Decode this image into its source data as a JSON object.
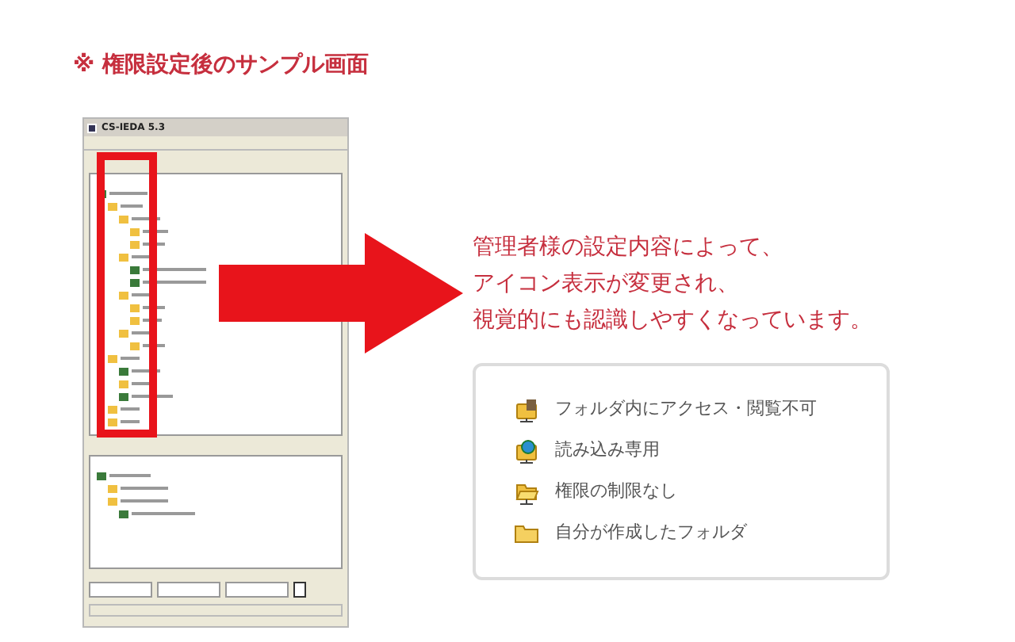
{
  "heading": "※ 権限設定後のサンプル画面",
  "screenshot": {
    "title": "CS-IEDA 5.3"
  },
  "message": [
    "管理者様の設定内容によって、",
    "アイコン表示が変更され、",
    "視覚的にも認識しやすくなっています。"
  ],
  "legend": [
    {
      "kind": "locked",
      "label": "フォルダ内にアクセス・閲覧不可"
    },
    {
      "kind": "readonly",
      "label": "読み込み専用"
    },
    {
      "kind": "open",
      "label": "権限の制限なし"
    },
    {
      "kind": "own",
      "label": "自分が作成したフォルダ"
    }
  ]
}
